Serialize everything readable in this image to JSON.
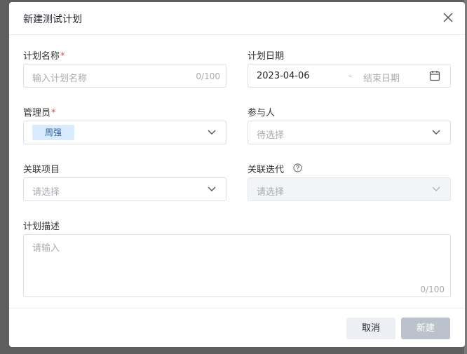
{
  "dialog": {
    "title": "新建测试计划",
    "close_icon": "close-icon"
  },
  "form": {
    "plan_name": {
      "label": "计划名称",
      "required_mark": "*",
      "placeholder": "输入计划名称",
      "counter": "0/100"
    },
    "plan_date": {
      "label": "计划日期",
      "start_value": "2023-04-06",
      "separator": "-",
      "end_placeholder": "结束日期",
      "icon": "calendar-icon"
    },
    "manager": {
      "label": "管理员",
      "required_mark": "*",
      "selected_tag": "周强",
      "icon": "chevron-down-icon"
    },
    "participants": {
      "label": "参与人",
      "placeholder": "待选择",
      "icon": "chevron-down-icon"
    },
    "linked_project": {
      "label": "关联项目",
      "placeholder": "请选择",
      "icon": "chevron-down-icon"
    },
    "linked_iteration": {
      "label": "关联迭代",
      "help_icon": "help-circle-icon",
      "placeholder": "请选择",
      "disabled": true,
      "icon": "chevron-down-icon"
    },
    "description": {
      "label": "计划描述",
      "placeholder": "请输入",
      "counter": "0/100"
    }
  },
  "footer": {
    "cancel_label": "取消",
    "create_label": "新建"
  },
  "colors": {
    "required": "#e34d59",
    "tag_bg": "#d9ecff",
    "disabled_button": "#bcc2cb"
  }
}
